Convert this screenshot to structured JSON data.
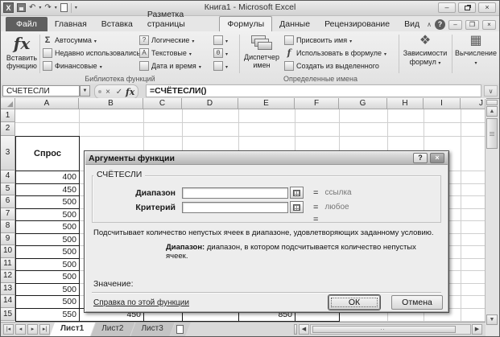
{
  "window": {
    "title": "Книга1 - Microsoft Excel"
  },
  "ribbon_tabs": {
    "file": "Файл",
    "items": [
      "Главная",
      "Вставка",
      "Разметка страницы",
      "Формулы",
      "Данные",
      "Рецензирование",
      "Вид"
    ],
    "active": "Формулы"
  },
  "ribbon": {
    "insert_function": {
      "line1": "Вставить",
      "line2": "функцию"
    },
    "library": {
      "label": "Библиотека функций",
      "col1": [
        "Автосумма",
        "Недавно использовались",
        "Финансовые"
      ],
      "col2": [
        "Логические",
        "Текстовые",
        "Дата и время"
      ]
    },
    "names": {
      "label": "Определенные имена",
      "manager1": "Диспетчер",
      "manager2": "имен",
      "items": [
        "Присвоить имя",
        "Использовать в формуле",
        "Создать из выделенного"
      ]
    },
    "dependencies": {
      "line1": "Зависимости",
      "line2": "формул"
    },
    "calculation": {
      "label": "Вычисление"
    }
  },
  "formula_bar": {
    "name_box": "СЧЕТЕСЛИ",
    "formula": "=СЧЁТЕСЛИ()"
  },
  "grid": {
    "column_labels": [
      "A",
      "B",
      "C",
      "D",
      "E",
      "F",
      "G",
      "H",
      "I",
      "J"
    ],
    "row_numbers": [
      1,
      2,
      3,
      4,
      5,
      6,
      7,
      8,
      9,
      10,
      11,
      12,
      13,
      14,
      15
    ],
    "cells": [
      {
        "r": 3,
        "c": "A",
        "text": "Спрос",
        "bold": true,
        "align": "center"
      },
      {
        "r": 4,
        "c": "A",
        "text": "400",
        "align": "right"
      },
      {
        "r": 5,
        "c": "A",
        "text": "450",
        "align": "right"
      },
      {
        "r": 6,
        "c": "A",
        "text": "500",
        "align": "right"
      },
      {
        "r": 7,
        "c": "A",
        "text": "500",
        "align": "right"
      },
      {
        "r": 8,
        "c": "A",
        "text": "500",
        "align": "right"
      },
      {
        "r": 9,
        "c": "A",
        "text": "500",
        "align": "right"
      },
      {
        "r": 10,
        "c": "A",
        "text": "500",
        "align": "right"
      },
      {
        "r": 11,
        "c": "A",
        "text": "500",
        "align": "right"
      },
      {
        "r": 12,
        "c": "A",
        "text": "500",
        "align": "right"
      },
      {
        "r": 13,
        "c": "A",
        "text": "500",
        "align": "right"
      },
      {
        "r": 14,
        "c": "A",
        "text": "500",
        "align": "right"
      },
      {
        "r": 15,
        "c": "A",
        "text": "550",
        "align": "right"
      },
      {
        "r": 15,
        "c": "B",
        "text": "450",
        "align": "right"
      },
      {
        "r": 15,
        "c": "C",
        "text": "",
        "align": "right"
      },
      {
        "r": 15,
        "c": "D",
        "text": "",
        "align": "right"
      },
      {
        "r": 15,
        "c": "E",
        "text": "850",
        "align": "right"
      },
      {
        "r": 15,
        "c": "F",
        "text": "",
        "align": "right"
      }
    ]
  },
  "dialog": {
    "title": "Аргументы функции",
    "function_name": "СЧЁТЕСЛИ",
    "equals": "=",
    "fields": [
      {
        "label": "Диапазон",
        "value": "",
        "result": "ссылка"
      },
      {
        "label": "Критерий",
        "value": "",
        "result": "любое"
      }
    ],
    "description": "Подсчитывает количество непустых ячеек в диапазоне, удовлетворяющих заданному условию.",
    "arg_name": "Диапазон:",
    "arg_desc": "диапазон, в котором подсчитывается количество непустых ячеек.",
    "value_label": "Значение:",
    "help_link": "Справка по этой функции",
    "ok": "ОК",
    "cancel": "Отмена"
  },
  "sheet_bar": {
    "tabs": [
      "Лист1",
      "Лист2",
      "Лист3"
    ],
    "active_tab": "Лист1"
  },
  "colors": {
    "grid_line": "#cfcfcf",
    "table_border": "#1a1a1a",
    "hint_text": "#777777"
  }
}
